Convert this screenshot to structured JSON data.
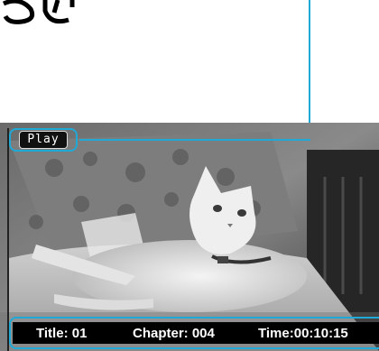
{
  "playback": {
    "state_label": "Play"
  },
  "status_bar": {
    "title": "Title: 01",
    "chapter": "Chapter: 004",
    "time": "Time:00:10:15"
  },
  "colors": {
    "callout": "#1fa9d6",
    "osd_background": "#000000",
    "osd_text": "#ffffff"
  },
  "icons": {
    "corner_glyph": "partial-character-glyph"
  }
}
